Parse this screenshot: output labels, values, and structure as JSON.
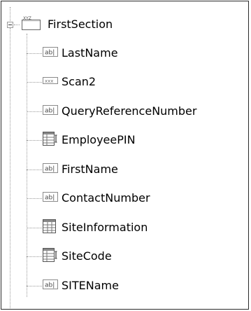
{
  "tree": {
    "root": {
      "label": "FirstSection",
      "icon": "section-xyz-icon",
      "badge": "XYZ"
    },
    "children": [
      {
        "label": "LastName",
        "icon": "textfield-icon",
        "icon_text": "ab|"
      },
      {
        "label": "Scan2",
        "icon": "barcode-icon",
        "icon_text": "xxx"
      },
      {
        "label": "QueryReferenceNumber",
        "icon": "textfield-icon",
        "icon_text": "ab|"
      },
      {
        "label": "EmployeePIN",
        "icon": "table-field-icon"
      },
      {
        "label": "FirstName",
        "icon": "textfield-icon",
        "icon_text": "ab|"
      },
      {
        "label": "ContactNumber",
        "icon": "textfield-icon",
        "icon_text": "ab|"
      },
      {
        "label": "SiteInformation",
        "icon": "table-block-icon"
      },
      {
        "label": "SiteCode",
        "icon": "table-field-icon"
      },
      {
        "label": "SITEName",
        "icon": "textfield-icon",
        "icon_text": "ab|"
      }
    ]
  }
}
